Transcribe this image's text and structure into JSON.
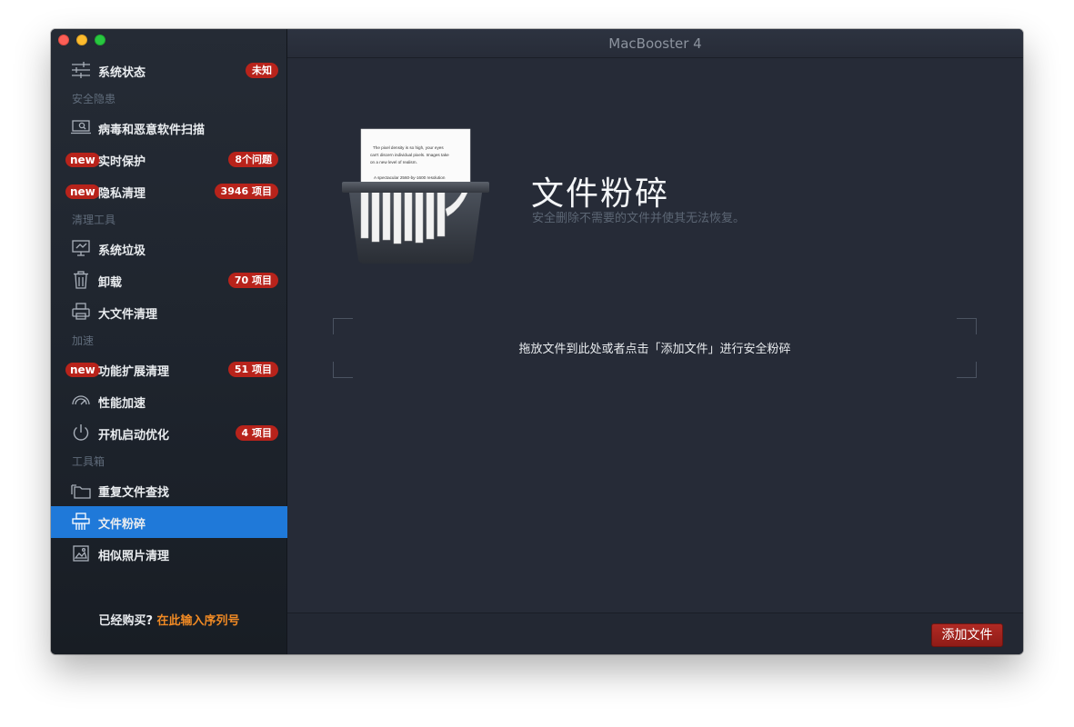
{
  "window": {
    "title": "MacBooster 4"
  },
  "sidebar": {
    "items": [
      {
        "label": "系统状态",
        "badge": "未知",
        "icon": "sliders-icon"
      },
      {
        "section": "安全隐患"
      },
      {
        "label": "病毒和恶意软件扫描",
        "icon": "laptop-scan-icon"
      },
      {
        "label": "实时保护",
        "new": "new",
        "badge": "8个问题",
        "icon": "none"
      },
      {
        "label": "隐私清理",
        "new": "new",
        "badge": "3946 项目",
        "icon": "none"
      },
      {
        "section": "清理工具"
      },
      {
        "label": "系统垃圾",
        "icon": "monitor-icon"
      },
      {
        "label": "卸载",
        "badge": "70 项目",
        "icon": "trash-icon"
      },
      {
        "label": "大文件清理",
        "icon": "printer-icon"
      },
      {
        "section": "加速"
      },
      {
        "label": "功能扩展清理",
        "new": "new",
        "badge": "51 项目",
        "icon": "none"
      },
      {
        "label": "性能加速",
        "icon": "speedometer-icon"
      },
      {
        "label": "开机启动优化",
        "badge": "4 项目",
        "icon": "power-icon"
      },
      {
        "section": "工具箱"
      },
      {
        "label": "重复文件查找",
        "icon": "folders-icon"
      },
      {
        "label": "文件粉碎",
        "icon": "shredder-icon",
        "active": true
      },
      {
        "label": "相似照片清理",
        "icon": "photo-icon"
      }
    ],
    "purchase": {
      "prefix": "已经购买?",
      "link": "在此输入序列号"
    }
  },
  "main": {
    "feature": {
      "title": "文件粉碎",
      "subtitle": "安全删除不需要的文件并使其无法恢复。"
    },
    "illustration": {
      "paper_lines": [
        "The pixel density is so high, your eyes",
        "can't discern individual pixels. Images take",
        "on a new level of realism.",
        "A spectacular 2560-by-1600 resolution"
      ]
    },
    "dropzone": {
      "text": "拖放文件到此处或者点击「添加文件」进行安全粉碎"
    },
    "add_button": "添加文件"
  },
  "colors": {
    "accent": "#1f79d9",
    "badge": "#b8231b",
    "link": "#f08a24",
    "button": "#a4241e"
  }
}
